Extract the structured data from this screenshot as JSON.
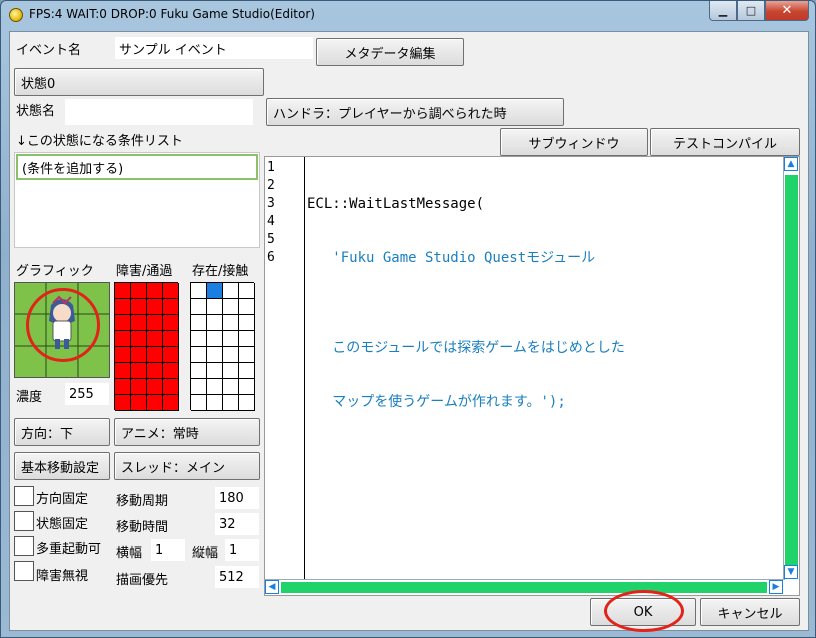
{
  "window": {
    "title": "FPS:4 WAIT:0 DROP:0 Fuku Game Studio(Editor)",
    "controls": {
      "minimize": "▁",
      "maximize": "□",
      "close": "✕"
    }
  },
  "event": {
    "name_label": "イベント名",
    "name_value": "サンプル イベント",
    "metadata_button": "メタデータ編集"
  },
  "state": {
    "state_button": "状態0",
    "state_name_label": "状態名",
    "state_name_value": "",
    "handler_button": "ハンドラ：プレイヤーから調べられた時",
    "condition_list_label": "↓この状態になる条件リスト",
    "condition_items": [
      "(条件を追加する)"
    ]
  },
  "toolbar": {
    "subwindow_button": "サブウィンドウ",
    "test_compile_button": "テストコンパイル"
  },
  "graphics": {
    "graphic_label": "グラフィック",
    "obstacle_label": "障害/通過",
    "presence_label": "存在/接触",
    "density_label": "濃度",
    "density_value": "255"
  },
  "controls": {
    "direction_button": "方向：下",
    "anime_button": "アニメ：常時",
    "basic_move_button": "基本移動設定",
    "thread_button": "スレッド：メイン"
  },
  "checks": [
    {
      "label": "方向固定"
    },
    {
      "label": "状態固定"
    },
    {
      "label": "多重起動可"
    },
    {
      "label": "障害無視"
    }
  ],
  "params": {
    "move_period_label": "移動周期",
    "move_period_value": "180",
    "move_time_label": "移動時間",
    "move_time_value": "32",
    "width_label": "横幅",
    "width_value": "1",
    "height_label": "縦幅",
    "height_value": "1",
    "draw_priority_label": "描画優先",
    "draw_priority_value": "512"
  },
  "editor": {
    "line_numbers": [
      "1",
      "2",
      "3",
      "4",
      "5",
      "6"
    ],
    "lines": [
      {
        "text": "ECL::WaitLastMessage(",
        "color": "black"
      },
      {
        "text": "   'Fuku Game Studio Questモジュール",
        "color": "blue"
      },
      {
        "text": "",
        "color": "black"
      },
      {
        "text": "   このモジュールでは探索ゲームをはじめとした",
        "color": "blue"
      },
      {
        "text": "   マップを使うゲームが作れます。');",
        "color": "blue"
      },
      {
        "text": "",
        "color": "black"
      }
    ]
  },
  "footer": {
    "ok_button": "OK",
    "cancel_button": "キャンセル"
  },
  "colors": {
    "obstacle_fill": "#ff0000",
    "presence_selected": "#1a7fe0",
    "scroll_thumb": "#1fd36a",
    "code_string": "#1a7fbf",
    "annotation_ring": "#e2231a"
  }
}
